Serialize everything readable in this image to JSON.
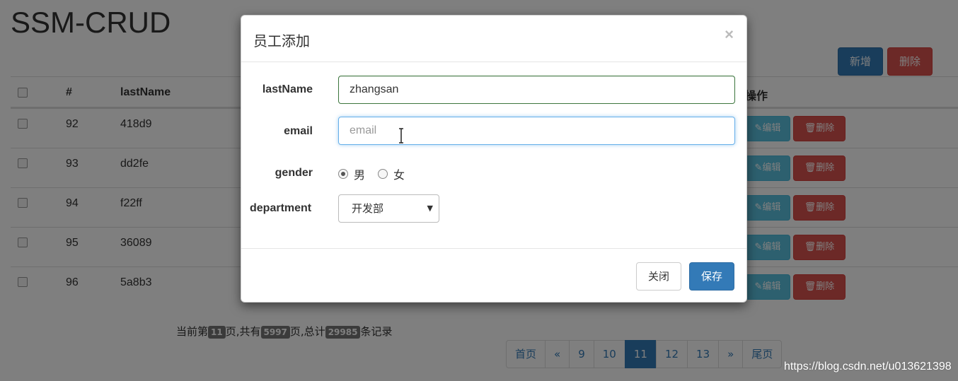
{
  "page": {
    "title": "SSM-CRUD",
    "add_button": "新增",
    "delete_button": "删除"
  },
  "table": {
    "columns": [
      "#",
      "lastName",
      "操作"
    ],
    "rows": [
      {
        "id": "92",
        "last_name": "418d9"
      },
      {
        "id": "93",
        "last_name": "dd2fe"
      },
      {
        "id": "94",
        "last_name": "f22ff"
      },
      {
        "id": "95",
        "last_name": "36089"
      },
      {
        "id": "96",
        "last_name": "5a8b3"
      }
    ],
    "edit_label": "编辑",
    "delete_label": "删除"
  },
  "page_info": {
    "prefix": "当前第",
    "current": "11",
    "mid1": "页,共有",
    "total_pages": "5997",
    "mid2": "页,总计",
    "total_records": "29985",
    "suffix": "条记录"
  },
  "pagination": {
    "first": "首页",
    "prev": "«",
    "pages": [
      "9",
      "10",
      "11",
      "12",
      "13"
    ],
    "active": "11",
    "next": "»",
    "last": "尾页"
  },
  "watermark": "https://blog.csdn.net/u013621398",
  "modal": {
    "title": "员工添加",
    "close_symbol": "×",
    "fields": {
      "last_name_label": "lastName",
      "last_name_value": "zhangsan",
      "email_label": "email",
      "email_value": "",
      "email_placeholder": "email",
      "gender_label": "gender",
      "gender_options": [
        "男",
        "女"
      ],
      "gender_selected": "男",
      "department_label": "department",
      "department_selected": "开发部"
    },
    "close_button": "关闭",
    "save_button": "保存"
  },
  "colors": {
    "primary": "#337ab7",
    "danger": "#d9534f",
    "info": "#5bc0de",
    "valid_border": "#3c763d",
    "focus_border": "#66afe9"
  }
}
